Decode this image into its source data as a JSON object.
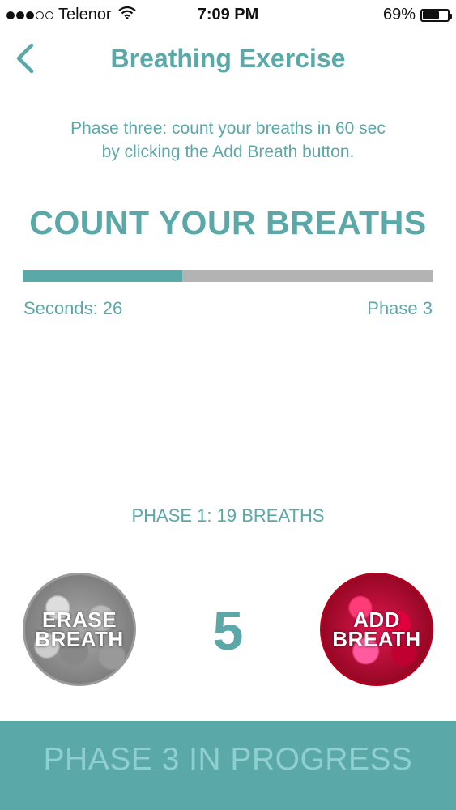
{
  "status_bar": {
    "carrier": "Telenor",
    "time": "7:09 PM",
    "battery_percent": "69%",
    "battery_level": 0.69,
    "signal_bars_filled": 3,
    "signal_bars_total": 5
  },
  "nav": {
    "title": "Breathing Exercise",
    "back_icon": "chevron-left-icon"
  },
  "instructions": {
    "line1": "Phase three: count your breaths in 60 sec",
    "line2": "by clicking the Add Breath button."
  },
  "headline": "COUNT YOUR BREATHS",
  "progress": {
    "seconds_label": "Seconds:",
    "seconds_value": "26",
    "fraction": 0.39,
    "phase_label": "Phase 3"
  },
  "summary": "PHASE 1: 19 BREATHS",
  "buttons": {
    "erase_line1": "ERASE",
    "erase_line2": "BREATH",
    "add_line1": "ADD",
    "add_line2": "BREATH"
  },
  "count": "5",
  "footer": {
    "label": "PHASE 3 IN PROGRESS"
  },
  "colors": {
    "accent": "#5aa8a8",
    "track": "#b3b3b3",
    "footer_text": "#8fcfcf"
  }
}
